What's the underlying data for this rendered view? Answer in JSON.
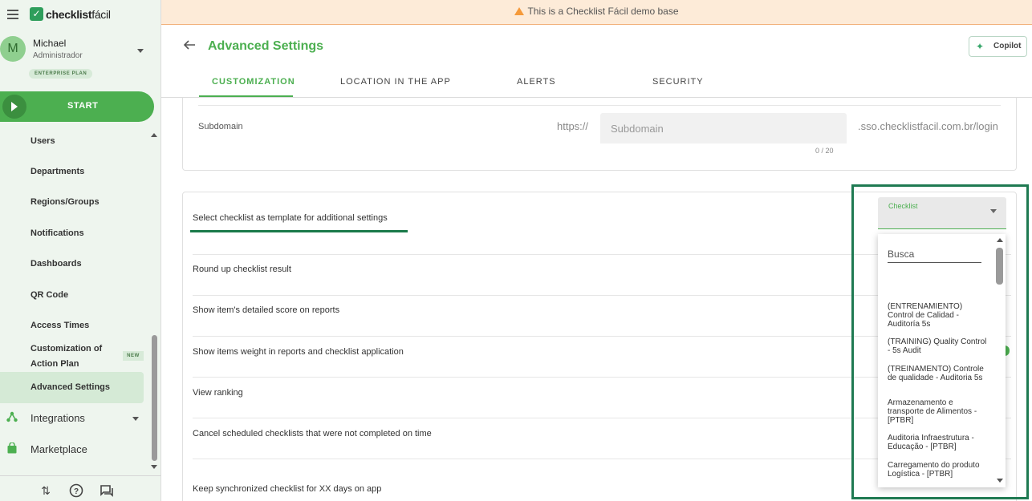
{
  "banner": {
    "text": "This is a Checklist Fácil demo base"
  },
  "brand": {
    "name_bold": "checklist",
    "name_light": "fácil"
  },
  "user": {
    "initial": "M",
    "name": "Michael",
    "role": "Administrador",
    "plan": "ENTERPRISE PLAN"
  },
  "sidebar": {
    "start_label": "START",
    "items": [
      {
        "label": "Users"
      },
      {
        "label": "Departments"
      },
      {
        "label": "Regions/Groups"
      },
      {
        "label": "Notifications"
      },
      {
        "label": "Dashboards"
      },
      {
        "label": "QR Code"
      },
      {
        "label": "Access Times"
      },
      {
        "label": "Customization of"
      },
      {
        "label": "Action Plan"
      },
      {
        "label": "Advanced Settings"
      }
    ],
    "new_badge": "NEW",
    "integrations": "Integrations",
    "marketplace": "Marketplace"
  },
  "header": {
    "title": "Advanced Settings",
    "copilot": "Copilot"
  },
  "tabs": [
    {
      "label": "CUSTOMIZATION"
    },
    {
      "label": "LOCATION IN THE APP"
    },
    {
      "label": "ALERTS"
    },
    {
      "label": "SECURITY"
    }
  ],
  "subdomain": {
    "label": "Subdomain",
    "prefix": "https://",
    "placeholder": "Subdomain",
    "counter": "0 / 20",
    "suffix": ".sso.checklistfacil.com.br/login"
  },
  "settings": [
    {
      "label": "Select checklist as template for additional settings"
    },
    {
      "label": "Round up checklist result"
    },
    {
      "label": "Show item's detailed score on reports"
    },
    {
      "label": "Show items weight in reports and checklist application"
    },
    {
      "label": "View ranking"
    },
    {
      "label": "Cancel scheduled checklists that were not completed on time"
    },
    {
      "label": "Keep synchronized checklist for XX days on app"
    }
  ],
  "checklist_select": {
    "label": "Checklist",
    "search_placeholder": "Busca",
    "options": [
      "(ENTRENAMIENTO) Control de Calidad - Auditoría 5s",
      "(TRAINING) Quality Control - 5s Audit",
      "(TREINAMENTO) Controle de qualidade - Auditoria 5s",
      "Armazenamento e transporte de Alimentos - [PTBR]",
      "Auditoria Infraestrutura - Educação - [PTBR]",
      "Carregamento do produto Logística - [PTBR]"
    ]
  },
  "colors": {
    "accent": "#4caf50",
    "highlight": "#1f7a52",
    "banner": "#fdebd8"
  }
}
